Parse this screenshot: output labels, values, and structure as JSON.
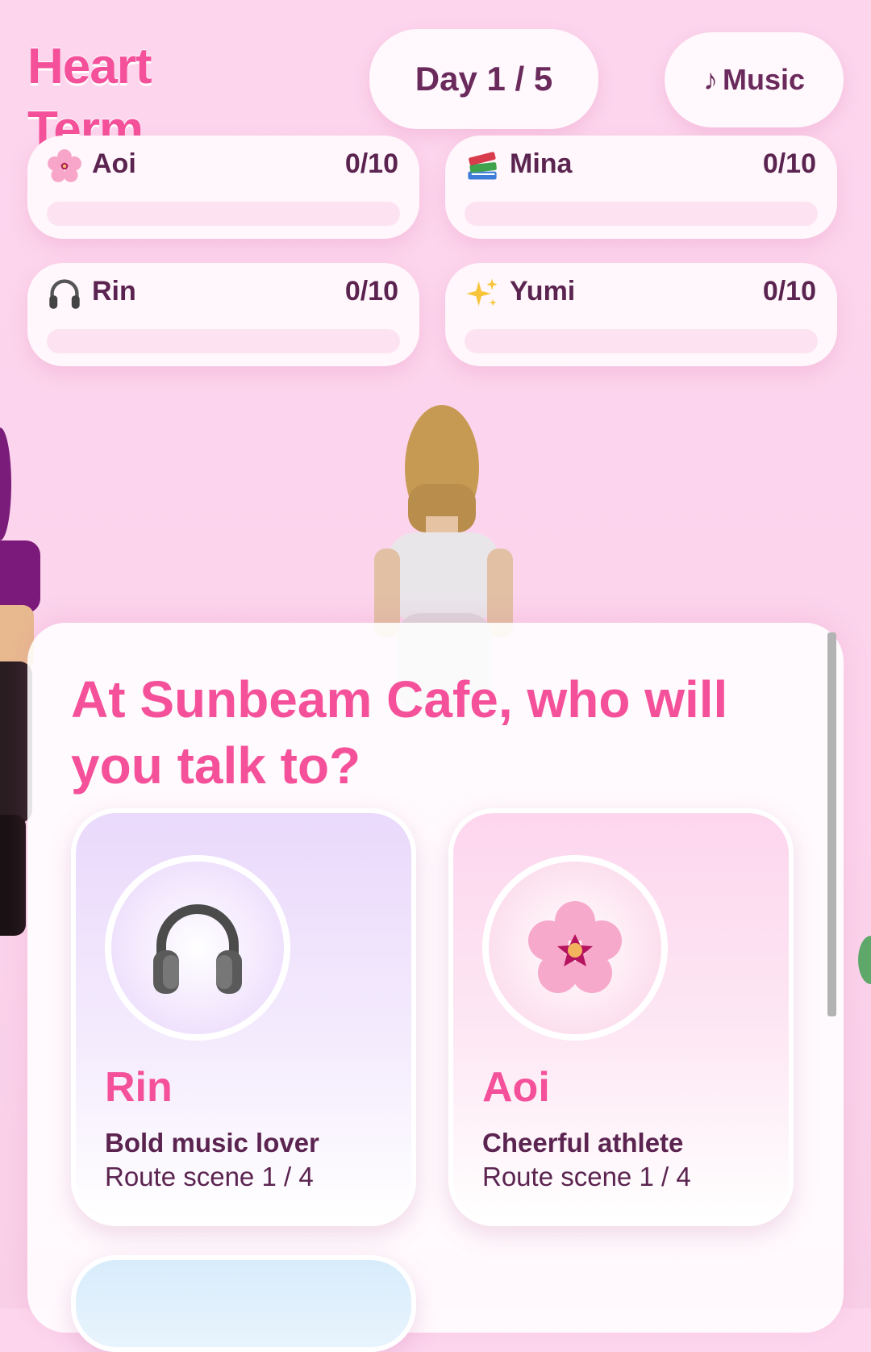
{
  "header": {
    "title": "Heart Term",
    "day": "Day 1 / 5",
    "music_label": "Music",
    "music_symbol": "♪"
  },
  "affection": [
    {
      "name": "Aoi",
      "icon": "cherry-blossom-icon",
      "score": "0/10",
      "progress": 0
    },
    {
      "name": "Mina",
      "icon": "books-icon",
      "score": "0/10",
      "progress": 0
    },
    {
      "name": "Rin",
      "icon": "headphones-icon",
      "score": "0/10",
      "progress": 0
    },
    {
      "name": "Yumi",
      "icon": "sparkles-icon",
      "score": "0/10",
      "progress": 0
    }
  ],
  "dialog": {
    "question": "At Sunbeam Cafe, who will you talk to?",
    "choices": [
      {
        "name": "Rin",
        "icon": "headphones-icon",
        "trait": "Bold music lover",
        "route": "Route scene 1 / 4"
      },
      {
        "name": "Aoi",
        "icon": "cherry-blossom-icon",
        "trait": "Cheerful athlete",
        "route": "Route scene 1 / 4"
      }
    ]
  },
  "colors": {
    "accent": "#f4519a",
    "text": "#5b2450",
    "background": "#fdd6ee"
  }
}
